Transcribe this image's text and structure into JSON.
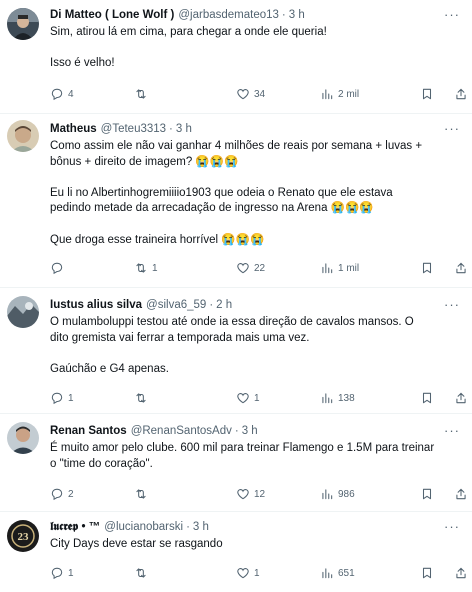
{
  "tweets": [
    {
      "name": "Di Matteo ( Lone Wolf )",
      "handle": "@jarbasdemateo13",
      "time": "3 h",
      "lines": [
        "Sim, atirou lá em cima, para chegar a onde ele queria!",
        "",
        "Isso é velho!"
      ],
      "stats": {
        "replies": "4",
        "retweets": "",
        "likes": "34",
        "views": "2 mil"
      },
      "avatar_color": "#3d4a55"
    },
    {
      "name": "Matheus",
      "handle": "@Teteu3313",
      "time": "3 h",
      "lines": [
        "Como assim ele não vai ganhar 4 milhões de reais por semana + luvas +",
        "bônus + direito de imagem? 😭😭😭",
        "",
        "Eu li no Albertinhogremiiiio1903 que odeia o Renato que ele estava",
        "pedindo metade da arrecadação de ingresso na Arena 😭😭😭",
        "",
        "Que droga esse traineira horrível 😭😭😭"
      ],
      "stats": {
        "replies": "",
        "retweets": "1",
        "likes": "22",
        "views": "1 mil"
      },
      "avatar_color": "#b9a98c"
    },
    {
      "name": "Iustus alius silva",
      "handle": "@silva6_59",
      "time": "2 h",
      "lines": [
        "O mulamboluppi testou até onde ia essa direção de cavalos mansos. O",
        "dito gremista vai ferrar a temporada mais uma vez.",
        "",
        "Gaúchão e G4 apenas."
      ],
      "stats": {
        "replies": "1",
        "retweets": "",
        "likes": "1",
        "views": "138"
      },
      "avatar_color": "#6f7c86"
    },
    {
      "name": "Renan Santos",
      "handle": "@RenanSantosAdv",
      "time": "3 h",
      "lines": [
        "É muito amor pelo clube. 600 mil para treinar Flamengo e 1.5M para treinar",
        "o \"time do coração\"."
      ],
      "stats": {
        "replies": "2",
        "retweets": "",
        "likes": "12",
        "views": "986"
      },
      "avatar_color": "#8a9aa4"
    },
    {
      "name": "𝖑𝖚𝖈𝖗𝖊𝖕 • ™",
      "handle": "@lucianobarski",
      "time": "3 h",
      "lines": [
        "City Days deve estar se rasgando"
      ],
      "stats": {
        "replies": "1",
        "retweets": "",
        "likes": "1",
        "views": "651"
      },
      "avatar_color": "#1b1b1b"
    }
  ]
}
